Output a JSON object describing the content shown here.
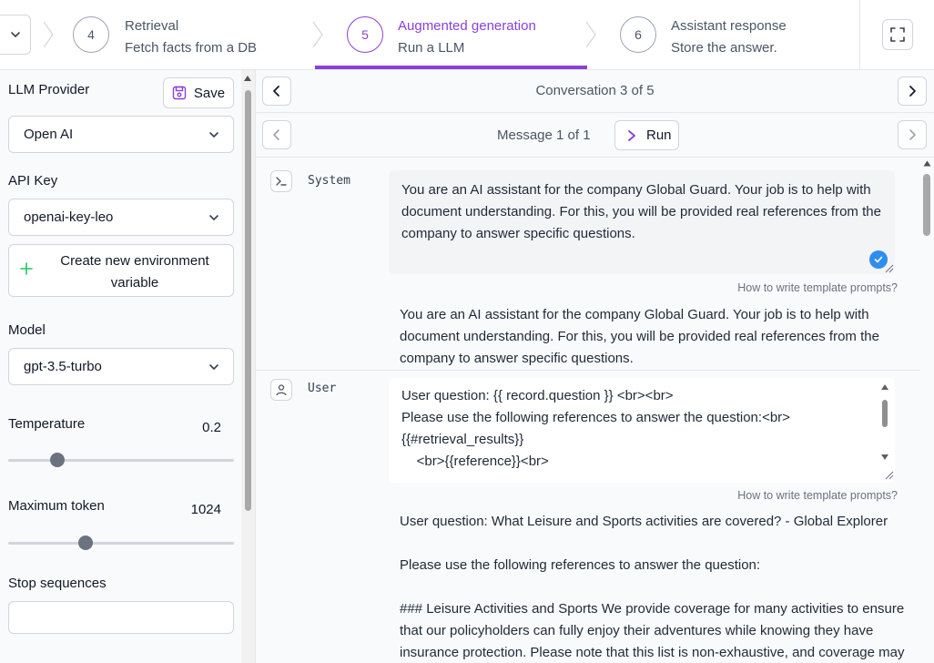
{
  "stepper": {
    "steps": [
      {
        "number": "4",
        "title": "Retrieval",
        "subtitle": "Fetch facts from a DB"
      },
      {
        "number": "5",
        "title": "Augmented generation",
        "subtitle": "Run a LLM"
      },
      {
        "number": "6",
        "title": "Assistant response",
        "subtitle": "Store the answer."
      }
    ],
    "active_step": "5",
    "accent_color": "#8b3fd9"
  },
  "settings": {
    "llm_provider_label": "LLM Provider",
    "save_label": "Save",
    "llm_provider_value": "Open AI",
    "api_key_label": "API Key",
    "api_key_value": "openai-key-leo",
    "create_env_label": "Create new environment variable",
    "model_label": "Model",
    "model_value": "gpt-3.5-turbo",
    "temperature_label": "Temperature",
    "temperature_value": "0.2",
    "temperature_fraction": 0.2,
    "max_token_label": "Maximum token",
    "max_token_value": "1024",
    "max_token_fraction": 0.33,
    "stop_sequences_label": "Stop sequences",
    "stop_sequences_value": ""
  },
  "navigation": {
    "conversation_label": "Conversation 3 of 5",
    "message_label": "Message 1 of 1",
    "run_label": "Run"
  },
  "messages": {
    "system": {
      "role": "System",
      "template": "You are an AI assistant for the company Global Guard. Your job is to help with document understanding. For this, you will be provided real references from the company to answer specific questions.",
      "help_link": "How to write template prompts?",
      "rendered": "You are an AI assistant for the company Global Guard. Your job is to help with document understanding. For this, you will be provided real references from the company to answer specific questions."
    },
    "user": {
      "role": "User",
      "template_lines": [
        "User question: {{ record.question }} <br><br>",
        "Please use the following references to answer the question:<br>",
        "{{#retrieval_results}}",
        "    <br>{{reference}}<br>"
      ],
      "help_link": "How to write template prompts?",
      "rendered_question": "User question: What Leisure and Sports activities are covered? - Global Explorer",
      "rendered_instruction": "Please use the following references to answer the question:",
      "rendered_reference": "### Leisure Activities and Sports We provide coverage for many activities to ensure that our policyholders can fully enjoy their adventures while knowing they have insurance protection. Please note that this list is non-exhaustive, and coverage may"
    }
  },
  "colors": {
    "accent": "#8b3fd9",
    "check": "#2f8df0",
    "plus": "#22c55e"
  }
}
